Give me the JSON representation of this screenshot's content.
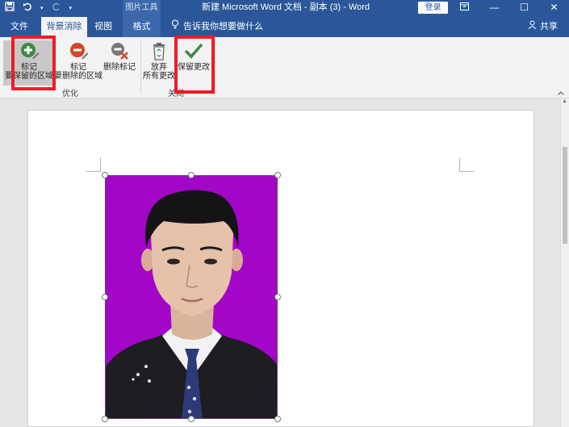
{
  "titlebar": {
    "context_group": "图片工具",
    "title": "新建 Microsoft Word 文档 - 副本 (3)  -  Word",
    "login": "登录"
  },
  "tabs": {
    "file": "文件",
    "background_removal": "背景消除",
    "view": "视图",
    "format": "格式",
    "tell_me": "告诉我你想要做什么",
    "share": "共享"
  },
  "ribbon": {
    "mark_keep": {
      "line1": "标记",
      "line2": "要保留的区域"
    },
    "mark_remove": {
      "line1": "标记",
      "line2": "要删除的区域"
    },
    "delete_mark": "删除标记",
    "discard": {
      "line1": "放弃",
      "line2": "所有更改"
    },
    "keep_changes": "保留更改",
    "group_refine": "优化",
    "group_close": "关闭"
  },
  "colors": {
    "accent": "#2b579a",
    "highlight_box": "#ee1c25",
    "photo_background": "#a206c6"
  }
}
